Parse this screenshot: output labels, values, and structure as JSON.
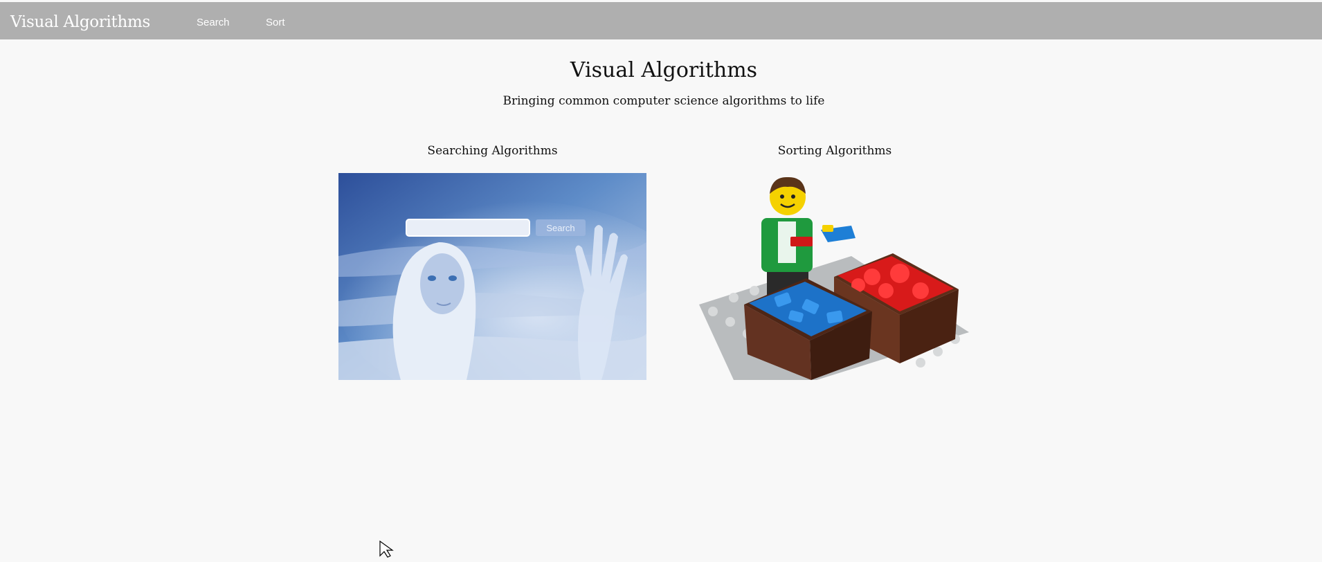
{
  "header": {
    "brand": "Visual Algorithms",
    "nav": [
      {
        "label": "Search"
      },
      {
        "label": "Sort"
      }
    ]
  },
  "main": {
    "title": "Visual Algorithms",
    "subtitle": "Bringing common computer science algorithms to life",
    "cards": [
      {
        "title": "Searching Algorithms",
        "image_text": "Search",
        "image_icon": "search-concept-image"
      },
      {
        "title": "Sorting Algorithms",
        "image_icon": "lego-sorting-image"
      }
    ]
  },
  "colors": {
    "topbar": "#afafaf",
    "background": "#f8f8f8"
  }
}
